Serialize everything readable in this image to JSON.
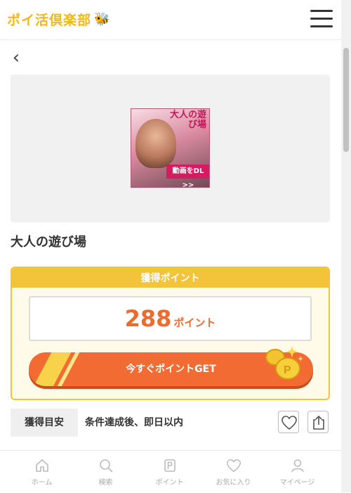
{
  "header": {
    "logo_text": "ポイ活倶楽部",
    "logo_icon": "bee-icon",
    "menu_icon": "hamburger-menu-icon"
  },
  "nav_back_icon": "chevron-left-icon",
  "banner": {
    "title": "大人の遊び場",
    "cta": "動画をDL >>"
  },
  "ad_title": "大人の遊び場",
  "points": {
    "header": "獲得ポイント",
    "value": "288",
    "unit": "ポイント",
    "button_label": "今すぐポイントGET"
  },
  "acquisition": {
    "label": "獲得目安",
    "text": "条件達成後、即日以内"
  },
  "actions": {
    "favorite_icon": "heart-icon",
    "share_icon": "share-icon"
  },
  "bottom_nav": [
    {
      "label": "ホーム",
      "icon": "home-icon"
    },
    {
      "label": "検索",
      "icon": "search-icon"
    },
    {
      "label": "ポイント",
      "icon": "point-icon"
    },
    {
      "label": "お気に入り",
      "icon": "heart-icon"
    },
    {
      "label": "マイページ",
      "icon": "user-icon"
    }
  ],
  "colors": {
    "brand_yellow": "#f3c43a",
    "accent_orange": "#f26b33",
    "points_text": "#ec6b2d"
  }
}
